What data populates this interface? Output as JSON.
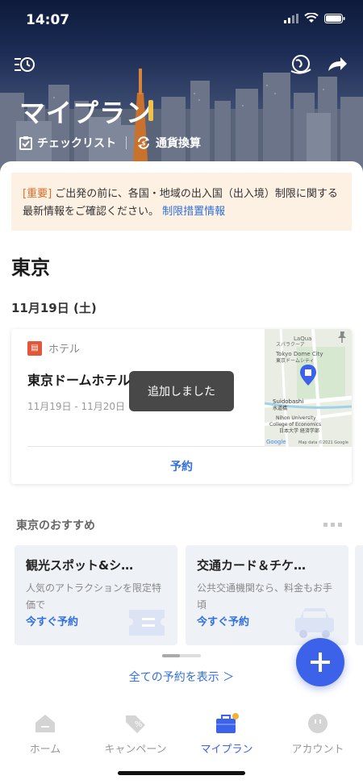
{
  "status_bar": {
    "time": "14:07"
  },
  "hero": {
    "title": "マイプラン",
    "checklist_label": "チェックリスト",
    "currency_label": "通貨換算"
  },
  "notice": {
    "tag": "[重要]",
    "text": "ご出発の前に、各国・地域の出入国（出入境）制限に関する最新情報をご確認ください。",
    "link": "制限措置情報"
  },
  "city": "東京",
  "date": "11月19日 (土)",
  "hotel": {
    "type_label": "ホテル",
    "name": "東京ドームホテル",
    "dates": "11月19日 - 11月20日",
    "reserve_label": "予約",
    "map": {
      "label_laqua": "LaQua",
      "label_spa": "スパラクーア",
      "label_dome": "Tokyo Dome City",
      "label_dome_jp": "東京ドームシティ",
      "label_suidobashi": "Suidobashi",
      "label_suidobashi_jp": "水道橋",
      "label_univ1": "Nihon University",
      "label_univ2": "College of Economics",
      "label_univ3": "日本大学 経済学部",
      "credit": "Map data ©2021 Google",
      "google": "Google"
    }
  },
  "toast": "追加しました",
  "recommend": {
    "heading": "東京のおすすめ",
    "cards": [
      {
        "title": "観光スポット&シ…",
        "desc": "人気のアトラクションを限定特価で",
        "cta": "今すぐ予約"
      },
      {
        "title": "交通カード＆チケ…",
        "desc": "公共交通機関なら、料金もお手頃",
        "cta": "今すぐ予約"
      }
    ]
  },
  "all_bookings": "全ての予約を表示 ＞",
  "tabs": [
    {
      "label": "ホーム",
      "icon": "home-icon"
    },
    {
      "label": "キャンペーン",
      "icon": "tag-icon"
    },
    {
      "label": "マイプラン",
      "icon": "briefcase-icon"
    },
    {
      "label": "アカウント",
      "icon": "account-icon"
    }
  ],
  "colors": {
    "accent": "#3b62e8",
    "notice_bg": "#fdf1e4",
    "notice_tag": "#e46a2a",
    "link": "#2f6fde"
  }
}
